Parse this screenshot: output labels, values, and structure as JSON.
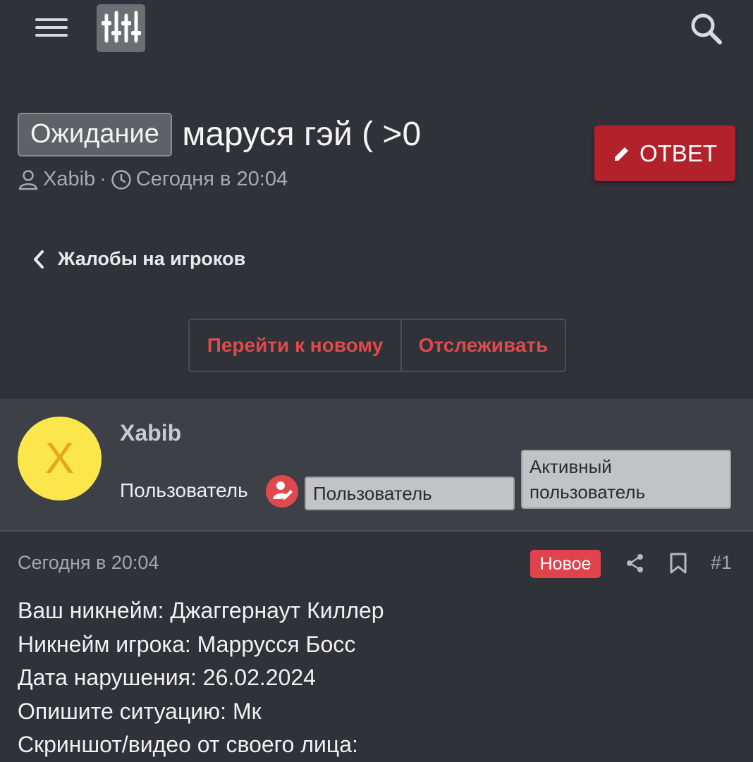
{
  "header": {
    "menu_icon": "hamburger-menu-icon",
    "logo_icon": "equalizer-sliders-logo",
    "search_icon": "search-icon"
  },
  "thread": {
    "prefix": "Ожидание",
    "title": "маруся гэй ( >0",
    "author": "Xabib",
    "separator": "·",
    "date": "Сегодня в 20:04",
    "reply_label": "ОТВЕТ",
    "reply_color": "#b3222a"
  },
  "breadcrumb": {
    "label": "Жалобы на игроков"
  },
  "actions": {
    "go_new": "Перейти к новому",
    "watch": "Отслеживать",
    "accent": "#e04a4a"
  },
  "user": {
    "avatar_letter": "X",
    "name": "Xabib",
    "title": "Пользователь",
    "banners": [
      "Пользователь",
      "Активный пользователь"
    ]
  },
  "post": {
    "date": "Сегодня в 20:04",
    "badge": "Новое",
    "number": "#1",
    "lines": [
      "Ваш никнейм: Джаггернаут Киллер",
      "Никнейм игрока: Маррусся Босс",
      "Дата нарушения: 26.02.2024",
      "Опишите ситуацию: Мк",
      "Скриншот/видео от своего лица:"
    ]
  }
}
